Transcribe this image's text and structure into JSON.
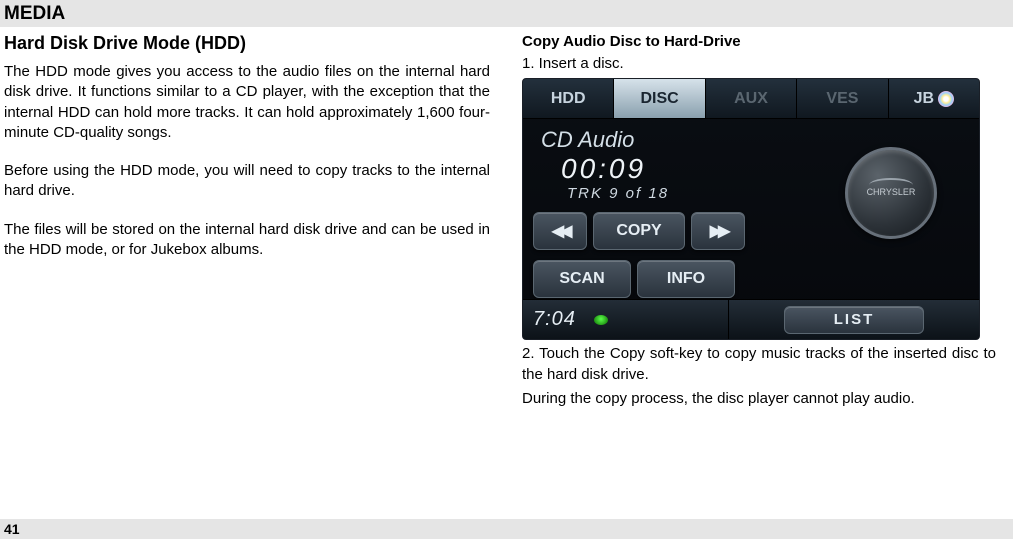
{
  "header": {
    "title": "MEDIA"
  },
  "left": {
    "heading": "Hard Disk Drive Mode (HDD)",
    "p1": "The HDD mode gives you access to the audio files on the internal hard disk drive. It functions similar to a CD player, with the exception that the internal HDD can hold more tracks. It can hold approximately 1,600 four-minute CD-quality songs.",
    "p2": "Before using the HDD mode, you will need to copy tracks to the internal hard drive.",
    "p3": "The files will be stored on the internal hard disk drive and can be used in the HDD mode, or for Jukebox albums."
  },
  "right": {
    "subheading": "Copy Audio Disc to Hard-Drive",
    "step1": "1. Insert a disc.",
    "caption": "2. Touch the Copy soft-key to copy music tracks of the inserted disc to the hard disk drive.",
    "note": "During the copy process, the disc player cannot play audio."
  },
  "nav": {
    "tabs": {
      "hdd": "HDD",
      "disc": "DISC",
      "aux": "AUX",
      "ves": "VES",
      "jb": "JB"
    },
    "cd_label": "CD Audio",
    "time": "00:09",
    "trk": "TRK 9 of 18",
    "copy": "COPY",
    "scan": "SCAN",
    "info": "INFO",
    "clock": "7:04",
    "list": "LIST"
  },
  "page": "41"
}
